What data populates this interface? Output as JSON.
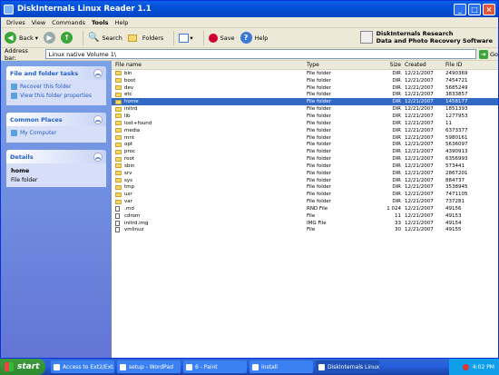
{
  "window": {
    "title": "DiskInternals Linux Reader 1.1",
    "controls": [
      "_",
      "□",
      "×"
    ]
  },
  "menu": [
    "Drives",
    "View",
    "Commands",
    "Tools",
    "Help"
  ],
  "toolbar": {
    "back": "Back",
    "search": "Search",
    "folders": "Folders",
    "save": "Save",
    "help": "Help",
    "brand_line1": "DiskInternals Research",
    "brand_line2": "Data and Photo Recovery Software"
  },
  "address": {
    "label": "Address bar:",
    "value": "Linux native Volume 1\\",
    "go": "Go"
  },
  "left": {
    "tasks_title": "File and folder tasks",
    "tasks": [
      "Recover this folder",
      "View this folder properties"
    ],
    "places_title": "Common Places",
    "places": [
      "My Computer"
    ],
    "details_title": "Details",
    "details_name": "home",
    "details_kind": "File folder"
  },
  "columns": {
    "name": "File name",
    "type": "Type",
    "size": "Size",
    "created": "Created",
    "id": "File ID"
  },
  "files": [
    {
      "name": "bin",
      "type": "File folder",
      "size": "DIR",
      "created": "12/21/2007",
      "id": "2490369",
      "icon": "folder"
    },
    {
      "name": "boot",
      "type": "File folder",
      "size": "DIR",
      "created": "12/21/2007",
      "id": "7454721",
      "icon": "folder"
    },
    {
      "name": "dev",
      "type": "File folder",
      "size": "DIR",
      "created": "12/21/2007",
      "id": "5685249",
      "icon": "folder"
    },
    {
      "name": "etc",
      "type": "File folder",
      "size": "DIR",
      "created": "12/21/2007",
      "id": "3833857",
      "icon": "folder"
    },
    {
      "name": "home",
      "type": "File folder",
      "size": "DIR",
      "created": "12/21/2007",
      "id": "1458177",
      "icon": "folder",
      "selected": true
    },
    {
      "name": "initrd",
      "type": "File folder",
      "size": "DIR",
      "created": "12/21/2007",
      "id": "1851393",
      "icon": "folder"
    },
    {
      "name": "lib",
      "type": "File folder",
      "size": "DIR",
      "created": "12/21/2007",
      "id": "1277953",
      "icon": "folder"
    },
    {
      "name": "lost+found",
      "type": "File folder",
      "size": "DIR",
      "created": "12/21/2007",
      "id": "11",
      "icon": "folder"
    },
    {
      "name": "media",
      "type": "File folder",
      "size": "DIR",
      "created": "12/21/2007",
      "id": "6373377",
      "icon": "folder"
    },
    {
      "name": "mnt",
      "type": "File folder",
      "size": "DIR",
      "created": "12/21/2007",
      "id": "5980161",
      "icon": "folder"
    },
    {
      "name": "opt",
      "type": "File folder",
      "size": "DIR",
      "created": "12/21/2007",
      "id": "5636097",
      "icon": "folder"
    },
    {
      "name": "proc",
      "type": "File folder",
      "size": "DIR",
      "created": "12/21/2007",
      "id": "4390913",
      "icon": "folder"
    },
    {
      "name": "root",
      "type": "File folder",
      "size": "DIR",
      "created": "12/21/2007",
      "id": "6356993",
      "icon": "folder"
    },
    {
      "name": "sbin",
      "type": "File folder",
      "size": "DIR",
      "created": "12/21/2007",
      "id": "573441",
      "icon": "folder"
    },
    {
      "name": "srv",
      "type": "File folder",
      "size": "DIR",
      "created": "12/21/2007",
      "id": "2867201",
      "icon": "folder"
    },
    {
      "name": "sys",
      "type": "File folder",
      "size": "DIR",
      "created": "12/21/2007",
      "id": "884737",
      "icon": "folder"
    },
    {
      "name": "tmp",
      "type": "File folder",
      "size": "DIR",
      "created": "12/21/2007",
      "id": "3538945",
      "icon": "folder"
    },
    {
      "name": "usr",
      "type": "File folder",
      "size": "DIR",
      "created": "12/21/2007",
      "id": "7471105",
      "icon": "folder"
    },
    {
      "name": "var",
      "type": "File folder",
      "size": "DIR",
      "created": "12/21/2007",
      "id": "737281",
      "icon": "folder"
    },
    {
      "name": ".rnd",
      "type": "RND File",
      "size": "1 024",
      "created": "12/21/2007",
      "id": "49156",
      "icon": "doc"
    },
    {
      "name": "cdrom",
      "type": "File",
      "size": "11",
      "created": "12/21/2007",
      "id": "49153",
      "icon": "doc"
    },
    {
      "name": "initrd.img",
      "type": "IMG File",
      "size": "33",
      "created": "12/21/2007",
      "id": "49154",
      "icon": "doc"
    },
    {
      "name": "vmlinuz",
      "type": "File",
      "size": "30",
      "created": "12/21/2007",
      "id": "49155",
      "icon": "doc"
    }
  ],
  "taskbar": {
    "start": "start",
    "tasks": [
      "Access to Ext2/Ext...",
      "setup - WordPad",
      "6 - Paint",
      "install",
      "DiskInternals Linux ..."
    ],
    "active_index": 4,
    "clock": "4:02 PM"
  }
}
